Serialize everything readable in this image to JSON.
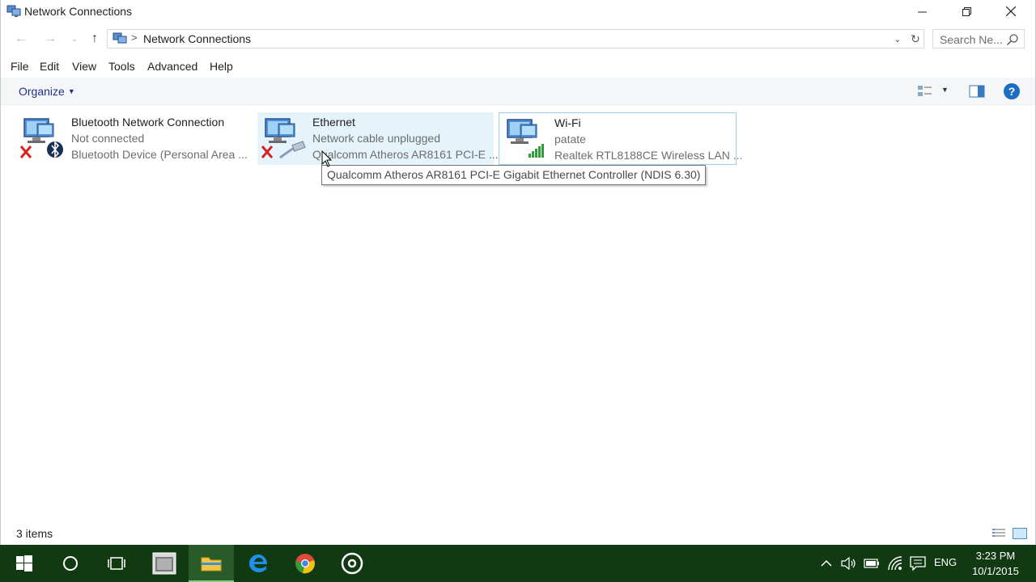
{
  "window": {
    "title": "Network Connections",
    "caption_buttons": {
      "minimize": "—",
      "maximize": "❐",
      "close": "✕"
    }
  },
  "nav": {
    "back_glyph": "←",
    "forward_glyph": "→",
    "recent_glyph": "⌄",
    "up_glyph": "↑"
  },
  "address": {
    "separator": ">",
    "path": "Network Connections",
    "dropdown_glyph": "⌄",
    "refresh_glyph": "↻"
  },
  "search": {
    "placeholder": "Search Ne..."
  },
  "menu": [
    "File",
    "Edit",
    "View",
    "Tools",
    "Advanced",
    "Help"
  ],
  "command_bar": {
    "organize_label": "Organize",
    "organize_caret": "▼",
    "view_caret": "▼",
    "help_label": "?"
  },
  "connections": [
    {
      "name": "Bluetooth Network Connection",
      "status": "Not connected",
      "device": "Bluetooth Device (Personal Area ...",
      "state": "disconnected",
      "icon": "bluetooth-icon"
    },
    {
      "name": "Ethernet",
      "status": "Network cable unplugged",
      "device": "Qualcomm Atheros AR8161 PCI-E ...",
      "state": "unplugged",
      "icon": "ethernet-cable-icon"
    },
    {
      "name": "Wi-Fi",
      "status": "patate",
      "device": "Realtek RTL8188CE Wireless LAN ...",
      "state": "connected",
      "icon": "wifi-signal-icon"
    }
  ],
  "tooltip": "Qualcomm Atheros AR8161 PCI-E Gigabit Ethernet Controller (NDIS 6.30)",
  "status_bar": {
    "item_count": "3 items"
  },
  "taskbar": {
    "language": "ENG",
    "time": "3:23 PM",
    "date": "10/1/2015"
  },
  "colors": {
    "taskbar": "#123a12",
    "selection": "#e5f3fb",
    "hover_border": "#99d1f4",
    "link_blue": "#1e3287",
    "help_blue": "#1b6ec2",
    "error_red": "#d92222"
  }
}
